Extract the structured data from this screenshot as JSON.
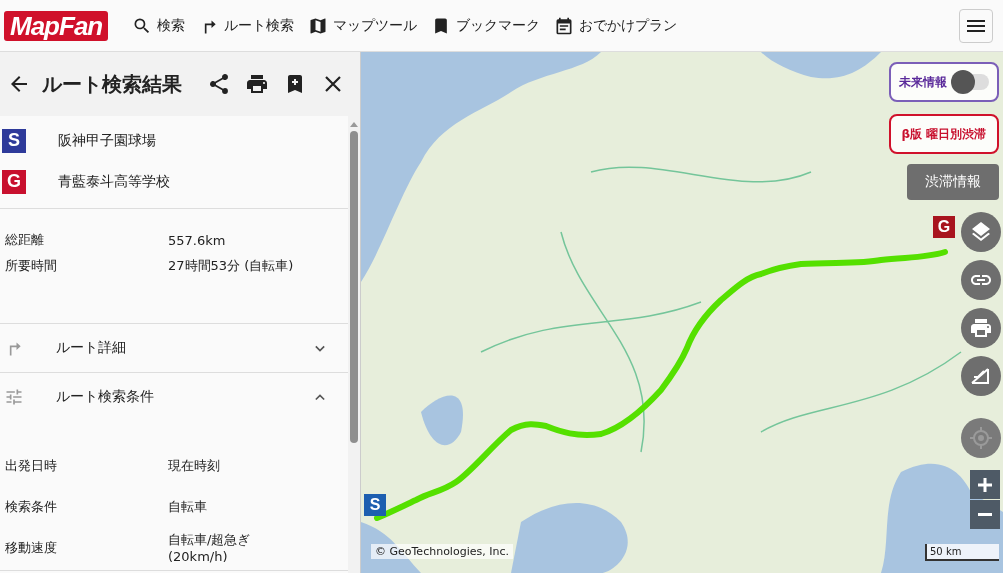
{
  "header": {
    "logo": "MapFan",
    "nav": [
      {
        "kind": "search",
        "label": "検索"
      },
      {
        "kind": "route",
        "label": "ルート検索"
      },
      {
        "kind": "map",
        "label": "マップツール"
      },
      {
        "kind": "bookmark",
        "label": "ブックマーク"
      },
      {
        "kind": "calendar",
        "label": "おでかけプラン"
      }
    ]
  },
  "panel": {
    "title": "ルート検索結果",
    "points": [
      {
        "kind": "start",
        "marker": "S",
        "name": "阪神甲子園球場"
      },
      {
        "kind": "goal",
        "marker": "G",
        "name": "青藍泰斗高等学校"
      }
    ],
    "summary": [
      {
        "label": "総距離",
        "value": "557.6km"
      },
      {
        "label": "所要時間",
        "value": "27時間53分 (自転車)"
      }
    ],
    "sections": [
      {
        "kind": "route",
        "label": "ルート詳細",
        "expanded": false
      },
      {
        "kind": "conditions",
        "label": "ルート検索条件",
        "expanded": true,
        "rows": [
          {
            "label": "出発日時",
            "value": "現在時刻"
          },
          {
            "label": "検索条件",
            "value": "自転車"
          },
          {
            "label": "移動速度",
            "value": "自転車/超急ぎ\n(20km/h)"
          }
        ]
      }
    ]
  },
  "map": {
    "future_info": {
      "label": "未来情報",
      "on": false
    },
    "beta_button": "β版 曜日別渋滞",
    "traffic_button": "渋滞情報",
    "start_marker": "S",
    "goal_marker": "G",
    "copyright": "© GeoTechnologies, Inc.",
    "scale": "50 km"
  }
}
